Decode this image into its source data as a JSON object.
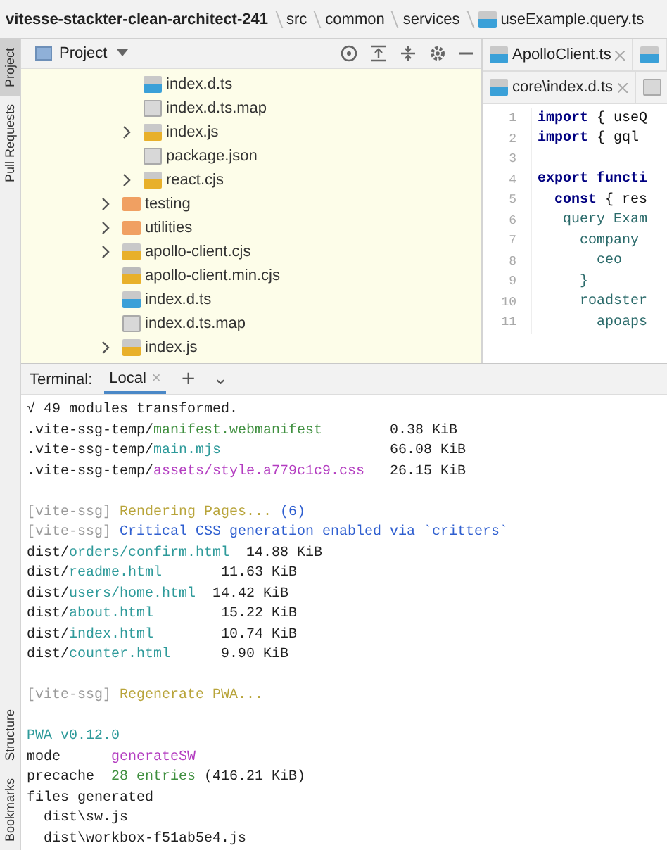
{
  "breadcrumb": [
    {
      "label": "vitesse-stackter-clean-architect-241"
    },
    {
      "label": "src"
    },
    {
      "label": "common"
    },
    {
      "label": "services"
    },
    {
      "label": "useExample.query.ts",
      "kind": "ts"
    }
  ],
  "side_strip": {
    "top": [
      {
        "label": "Project",
        "selected": true
      },
      {
        "label": "Pull Requests",
        "selected": false
      }
    ],
    "bottom": [
      {
        "label": "Structure",
        "selected": false
      },
      {
        "label": "Bookmarks",
        "selected": false
      }
    ]
  },
  "project_panel": {
    "title": "Project",
    "tree": [
      {
        "children": [
          {
            "name": "index.d.ts",
            "kind": "ts"
          },
          {
            "name": "index.d.ts.map",
            "kind": "map"
          },
          {
            "name": "index.js",
            "kind": "js",
            "expanded": false
          },
          {
            "name": "package.json",
            "kind": "map"
          },
          {
            "name": "react.cjs",
            "kind": "js",
            "expanded": false
          }
        ]
      },
      {
        "name": "testing",
        "kind": "folder",
        "expanded": false
      },
      {
        "name": "utilities",
        "kind": "folder",
        "expanded": false
      },
      {
        "name": "apollo-client.cjs",
        "kind": "js",
        "expanded": false
      },
      {
        "name": "apollo-client.min.cjs",
        "kind": "minjs"
      },
      {
        "name": "index.d.ts",
        "kind": "ts"
      },
      {
        "name": "index.d.ts.map",
        "kind": "map"
      },
      {
        "name": "index.js",
        "kind": "js",
        "expanded": false
      }
    ]
  },
  "editor": {
    "tab_rows": [
      [
        {
          "label": "ApolloClient.ts",
          "kind": "ts"
        },
        {
          "kind": "ts"
        }
      ],
      [
        {
          "label": "core\\index.d.ts",
          "kind": "ts"
        },
        {
          "kind": "map"
        }
      ]
    ],
    "lines": [
      {
        "no": "1",
        "tokens": [
          {
            "t": "import",
            "kind": "kw"
          },
          {
            "t": " { useQ",
            "kind": "plain"
          }
        ]
      },
      {
        "no": "2",
        "tokens": [
          {
            "t": "import",
            "kind": "kw"
          },
          {
            "t": " { gql",
            "kind": "plain"
          }
        ]
      },
      {
        "no": "3"
      },
      {
        "no": "4",
        "tokens": [
          {
            "t": "export functi",
            "kind": "kw"
          }
        ]
      },
      {
        "no": "5",
        "tokens": [
          {
            "t": "  const",
            "kind": "kw"
          },
          {
            "t": " { res",
            "kind": "plain"
          }
        ]
      },
      {
        "no": "6",
        "tokens": [
          {
            "t": "   query Exam",
            "kind": "gql"
          }
        ]
      },
      {
        "no": "7",
        "tokens": [
          {
            "t": "     company",
            "kind": "gql"
          }
        ]
      },
      {
        "no": "8",
        "tokens": [
          {
            "t": "       ceo",
            "kind": "gql"
          }
        ]
      },
      {
        "no": "9",
        "tokens": [
          {
            "t": "     }",
            "kind": "gql"
          }
        ]
      },
      {
        "no": "10",
        "tokens": [
          {
            "t": "     roadster",
            "kind": "gql"
          }
        ]
      },
      {
        "no": "11",
        "tokens": [
          {
            "t": "       apoaps",
            "kind": "gql"
          }
        ]
      }
    ]
  },
  "terminal": {
    "label": "Terminal:",
    "tabs": [
      {
        "label": "Local",
        "selected": true,
        "close": "×"
      }
    ],
    "add": "+",
    "more": "⌄",
    "lines": [
      {
        "segments": [
          {
            "t": "√ 49 modules transformed.",
            "kind": "plain"
          }
        ]
      },
      {
        "segments": [
          {
            "t": ".vite-ssg-temp/",
            "kind": "plain"
          },
          {
            "t": "manifest.webmanifest",
            "kind": "green"
          },
          {
            "t": "        0.38 KiB",
            "kind": "plain"
          }
        ]
      },
      {
        "segments": [
          {
            "t": ".vite-ssg-temp/",
            "kind": "plain"
          },
          {
            "t": "main.mjs",
            "kind": "file"
          },
          {
            "t": "                    66.08 KiB",
            "kind": "plain"
          }
        ]
      },
      {
        "segments": [
          {
            "t": ".vite-ssg-temp/",
            "kind": "plain"
          },
          {
            "t": "assets/style.a779c1c9.css",
            "kind": "asset"
          },
          {
            "t": "   26.15 KiB",
            "kind": "plain"
          }
        ]
      },
      {
        "kind": "blank"
      },
      {
        "segments": [
          {
            "t": "[vite-ssg] ",
            "kind": "muted"
          },
          {
            "t": "Rendering Pages... ",
            "kind": "notice"
          },
          {
            "t": "(6)",
            "kind": "info"
          }
        ]
      },
      {
        "segments": [
          {
            "t": "[vite-ssg] ",
            "kind": "muted"
          },
          {
            "t": "Critical CSS generation enabled via `critters`",
            "kind": "info"
          }
        ]
      },
      {
        "segments": [
          {
            "t": "dist/",
            "kind": "plain"
          },
          {
            "t": "orders/confirm.html",
            "kind": "file"
          },
          {
            "t": "  14.88 KiB",
            "kind": "plain"
          }
        ]
      },
      {
        "segments": [
          {
            "t": "dist/",
            "kind": "plain"
          },
          {
            "t": "readme.html",
            "kind": "file"
          },
          {
            "t": "       11.63 KiB",
            "kind": "plain"
          }
        ]
      },
      {
        "segments": [
          {
            "t": "dist/",
            "kind": "plain"
          },
          {
            "t": "users/home.html",
            "kind": "file"
          },
          {
            "t": "  14.42 KiB",
            "kind": "plain"
          }
        ]
      },
      {
        "segments": [
          {
            "t": "dist/",
            "kind": "plain"
          },
          {
            "t": "about.html",
            "kind": "file"
          },
          {
            "t": "        15.22 KiB",
            "kind": "plain"
          }
        ]
      },
      {
        "segments": [
          {
            "t": "dist/",
            "kind": "plain"
          },
          {
            "t": "index.html",
            "kind": "file"
          },
          {
            "t": "        10.74 KiB",
            "kind": "plain"
          }
        ]
      },
      {
        "segments": [
          {
            "t": "dist/",
            "kind": "plain"
          },
          {
            "t": "counter.html",
            "kind": "file"
          },
          {
            "t": "      9.90 KiB",
            "kind": "plain"
          }
        ]
      },
      {
        "kind": "blank"
      },
      {
        "segments": [
          {
            "t": "[vite-ssg] ",
            "kind": "muted"
          },
          {
            "t": "Regenerate PWA...",
            "kind": "notice"
          }
        ]
      },
      {
        "kind": "blank"
      },
      {
        "segments": [
          {
            "t": "PWA v0.12.0",
            "kind": "file"
          }
        ]
      },
      {
        "segments": [
          {
            "t": "mode      ",
            "kind": "plain"
          },
          {
            "t": "generateSW",
            "kind": "asset"
          }
        ]
      },
      {
        "segments": [
          {
            "t": "precache  ",
            "kind": "plain"
          },
          {
            "t": "28 entries",
            "kind": "green"
          },
          {
            "t": " (416.21 KiB)",
            "kind": "plain"
          }
        ]
      },
      {
        "segments": [
          {
            "t": "files generated",
            "kind": "plain"
          }
        ]
      },
      {
        "segments": [
          {
            "t": "  dist\\sw.js",
            "kind": "plain"
          }
        ]
      },
      {
        "segments": [
          {
            "t": "  dist\\workbox-f51ab5e4.js",
            "kind": "plain"
          }
        ]
      }
    ]
  }
}
